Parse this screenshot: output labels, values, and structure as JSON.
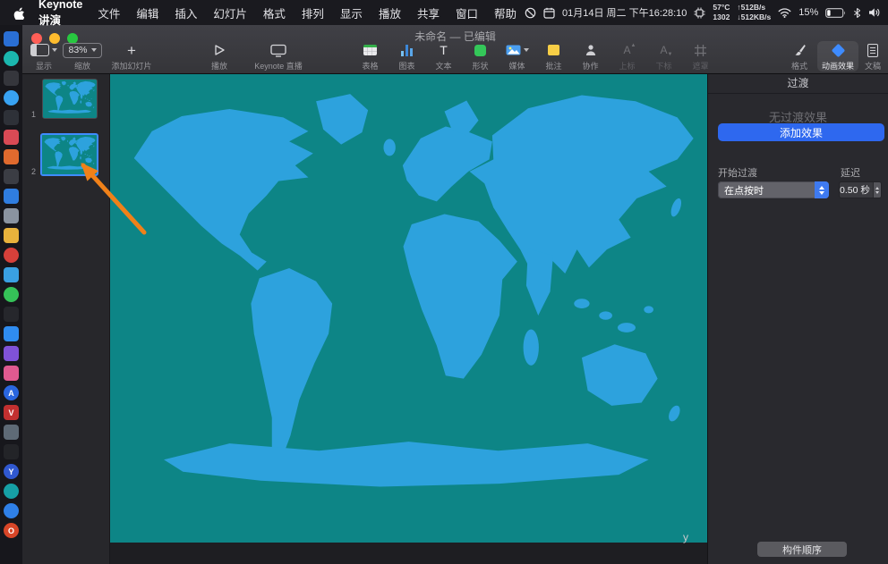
{
  "menu_bar": {
    "app_name": "Keynote 讲演",
    "menus": [
      "文件",
      "编辑",
      "插入",
      "幻灯片",
      "格式",
      "排列",
      "显示",
      "播放",
      "共享",
      "窗口",
      "帮助"
    ],
    "status": {
      "date_text": "01月14日 周二 下午16:28:10",
      "temp": "57°C",
      "fan_rpm": "1302",
      "net_up": "↑512B/s",
      "net_down": "↓512KB/s",
      "battery_percent": "15%"
    }
  },
  "toolbar": {
    "title": "未命名 — 已编辑",
    "view_label": "显示",
    "zoom_value": "83%",
    "zoom_label": "缩放",
    "add_slide_label": "添加幻灯片",
    "play_label": "播放",
    "live_label": "Keynote 直播",
    "table_label": "表格",
    "chart_label": "图表",
    "text_label": "文本",
    "shape_label": "形状",
    "media_label": "媒体",
    "comment_label": "批注",
    "collab_label": "协作",
    "sup_label": "上标",
    "sub_label": "下标",
    "mask_label": "遮罩",
    "format_label": "格式",
    "animate_label": "动画效果",
    "document_label": "文稿"
  },
  "navigator": {
    "slides": [
      {
        "number": "1",
        "selected": false
      },
      {
        "number": "2",
        "selected": true
      }
    ]
  },
  "canvas": {
    "stray_text": "y"
  },
  "inspector": {
    "header": "过渡",
    "empty_state": "无过渡效果",
    "add_effect_button": "添加效果",
    "start_transition_label": "开始过渡",
    "start_transition_value": "在点按时",
    "delay_label": "延迟",
    "delay_value": "0.50 秒",
    "build_order_button": "构件顺序"
  },
  "colors": {
    "slide_background": "#0d8586",
    "land": "#2da2dd",
    "accent_blue": "#2e68ef",
    "selection_blue": "#3f8cff",
    "annotation_orange": "#f08119"
  },
  "dock": {
    "icons": [
      {
        "name": "dock-icon-1",
        "color": "#2a6fd4",
        "shape": "square"
      },
      {
        "name": "dock-icon-2",
        "color": "#1bb7ae",
        "shape": "circle"
      },
      {
        "name": "dock-icon-3",
        "color": "#35363c",
        "shape": "square"
      },
      {
        "name": "dock-icon-4",
        "color": "#38a2f2",
        "shape": "circle"
      },
      {
        "name": "dock-icon-5",
        "color": "#2e3138",
        "shape": "square"
      },
      {
        "name": "dock-icon-6",
        "color": "#d94a55",
        "shape": "square"
      },
      {
        "name": "dock-icon-7",
        "color": "#e06a2e",
        "shape": "square"
      },
      {
        "name": "dock-icon-8",
        "color": "#3b3d44",
        "shape": "square"
      },
      {
        "name": "dock-icon-9",
        "color": "#2f7de0",
        "shape": "square"
      },
      {
        "name": "dock-icon-10",
        "color": "#8a93a0",
        "shape": "square"
      },
      {
        "name": "dock-icon-11",
        "color": "#e8b23c",
        "shape": "square"
      },
      {
        "name": "dock-icon-12",
        "color": "#d6403a",
        "shape": "circle"
      },
      {
        "name": "dock-icon-13",
        "color": "#3aa0e2",
        "shape": "square"
      },
      {
        "name": "dock-icon-14",
        "color": "#35c258",
        "shape": "circle"
      },
      {
        "name": "dock-icon-15",
        "color": "#26272c",
        "shape": "square"
      },
      {
        "name": "dock-icon-16",
        "color": "#2f8cf0",
        "shape": "square"
      },
      {
        "name": "dock-icon-17",
        "color": "#8052d8",
        "shape": "square"
      },
      {
        "name": "dock-icon-18",
        "color": "#e05a90",
        "shape": "square"
      },
      {
        "name": "dock-icon-19",
        "color": "#2a66e0",
        "shape": "circle",
        "glyph": "A"
      },
      {
        "name": "dock-icon-20",
        "color": "#c23030",
        "shape": "square",
        "glyph": "V"
      },
      {
        "name": "dock-icon-21",
        "color": "#5e6a76",
        "shape": "square"
      },
      {
        "name": "dock-icon-22",
        "color": "#232428",
        "shape": "square"
      },
      {
        "name": "dock-icon-23",
        "color": "#3058d0",
        "shape": "circle",
        "glyph": "Y"
      },
      {
        "name": "dock-icon-24",
        "color": "#16a0a6",
        "shape": "circle"
      },
      {
        "name": "dock-icon-25",
        "color": "#2f80e8",
        "shape": "circle"
      },
      {
        "name": "dock-icon-26",
        "color": "#d84628",
        "shape": "circle",
        "glyph": "O"
      }
    ]
  }
}
